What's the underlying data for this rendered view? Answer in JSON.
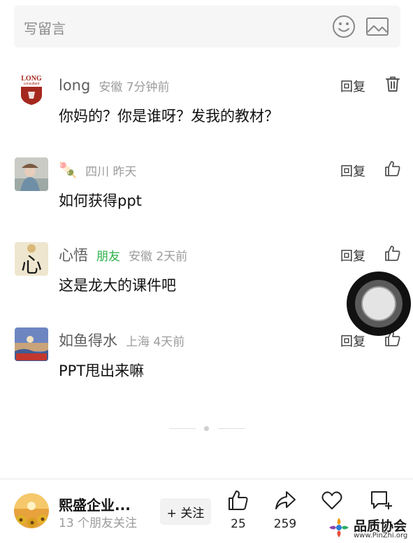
{
  "compose": {
    "placeholder": "写留言",
    "emoji_icon": "smiley-face-icon",
    "image_icon": "image-icon"
  },
  "comments": [
    {
      "nickname": "long",
      "friend_tag": "",
      "location_time": "安徽 7分钟前",
      "reply_label": "回复",
      "action_icon": "trash-icon",
      "text": "你妈的？你是谁呀？发我的教材？",
      "avatar_logo_text": "LONG",
      "avatar_logo_sub": "consultant"
    },
    {
      "nickname": "🍡",
      "friend_tag": "",
      "location_time": "四川 昨天",
      "reply_label": "回复",
      "action_icon": "thumbs-up-icon",
      "text": "如何获得ppt"
    },
    {
      "nickname": "心悟",
      "friend_tag": "朋友",
      "location_time": "安徽 2天前",
      "reply_label": "回复",
      "action_icon": "thumbs-up-icon",
      "text": "这是龙大的课件吧",
      "avatar_char": "心"
    },
    {
      "nickname": "如鱼得水",
      "friend_tag": "",
      "location_time": "上海 4天前",
      "reply_label": "回复",
      "action_icon": "thumbs-up-icon",
      "text": "PPT甩出来嘛"
    }
  ],
  "bottom_bar": {
    "account_name": "熙盛企业...",
    "followers": "13 个朋友关注",
    "follow_label": "+ 关注",
    "like_count": "25",
    "share_count": "259",
    "favorite_count": "",
    "comment_count": ""
  },
  "watermark": {
    "title": "品质协会",
    "url": "www.PinZhi.org"
  },
  "colors": {
    "friend_green": "#2bb04a",
    "meta_gray": "#9c9c9c",
    "compose_bg": "#f6f6f6"
  }
}
